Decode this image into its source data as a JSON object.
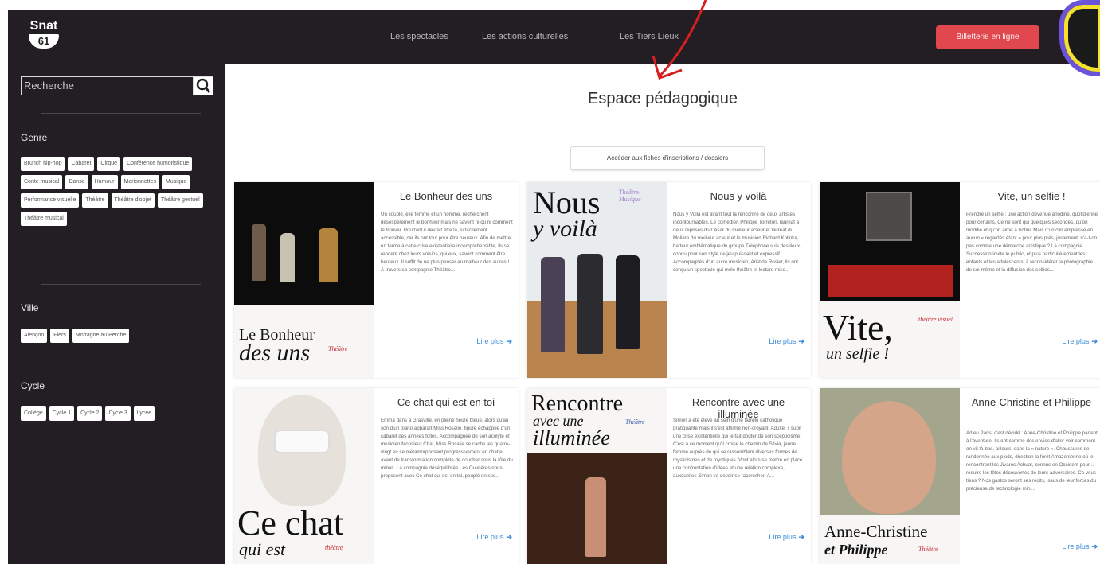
{
  "logo": {
    "line1": "Snat",
    "line2": "61"
  },
  "nav": [
    "Les spectacles",
    "Les actions culturelles",
    "Les Tiers Lieux"
  ],
  "ticket_button": "Billetterie en ligne",
  "search": {
    "placeholder": "Recherche"
  },
  "filters": [
    {
      "title": "Genre",
      "tags": [
        "Brunch hip-hop",
        "Cabaret",
        "Cirque",
        "Conférence humoristique",
        "Conte musical",
        "Danse",
        "Humour",
        "Marionnettes",
        "Musique",
        "Performance visuelle",
        "Théâtre",
        "Théâtre d'objet",
        "Théâtre gestuel",
        "Théâtre musical"
      ]
    },
    {
      "title": "Ville",
      "tags": [
        "Alençon",
        "Flers",
        "Mortagne au Perche"
      ]
    },
    {
      "title": "Cycle",
      "tags": [
        "Collège",
        "Cycle 1",
        "Cycle 2",
        "Cycle 3",
        "Lycée"
      ]
    }
  ],
  "page_title": "Espace pédagogique",
  "fiches_button": "Accéder aux fiches d'inscriptions / dossiers",
  "read_more": "Lire plus",
  "cards": [
    {
      "title": "Le Bonheur des uns",
      "poster": [
        "Le Bonheur",
        "des uns"
      ],
      "poster_tag": "Théâtre",
      "text": "Un couple, elle femme et un homme, recherchent désespérément le bonheur mais ne savent ni où ni comment le trouver. Pourtant il devrait être là, si facilement accessible, car ils ont tout pour être heureux. Afin de mettre un terme à cette crise existentielle incompréhensible, ils se rendent chez leurs voisins, qui eux, savent comment être heureux. Il suffit de ne plus penser au malheur des autres ! À travers sa compagnie Théâtre..."
    },
    {
      "title": "Nous y voilà",
      "poster": [
        "Nous",
        "y voilà"
      ],
      "poster_tag": "Théâtre/ Musique",
      "text": "Nous y Voilà est avant tout la rencontre de deux artistes incontournables. Le comédien Philippe Torreton, lauréat à deux reprises du César du meilleur acteur et lauréat du Molière du meilleur acteur et le musicien Richard Kolinka, batteur emblématique du groupe Téléphone suis des lieux, connu pour son style de jeu puissant et expressif. Accompagnés d'un autre musicien, Aristide Rosier, ils ont conçu un spectacle qui mêle théâtre et lecture mise..."
    },
    {
      "title": "Vite, un selfie !",
      "poster": [
        "Vite,",
        "un selfie !"
      ],
      "poster_tag": "théâtre visuel",
      "text": "Prendre un selfie : une action devenue anodine, quotidienne pour certains. Ce ne sont qui quelques secondes, qu'on modifie et qu'on aime à l'infini. Mais d'un clin empressé en aucun « regardés étant » pour plus près, justement, n'a-t-on pas comme une démarche artistique ? La compagnie Succession invite le public, et plus particulièrement les enfants et les adolescents, à reconsidérer la photographie de soi-même et la diffusion des selfies..."
    },
    {
      "title": "Ce chat qui est en toi",
      "poster": [
        "Ce chat",
        "qui est"
      ],
      "poster_tag": "théâtre",
      "text": "Emma dans à Grasville, en pleine heure bleue, alors qu'au son d'un piano apparaît Miss Rosalie, figure échappée d'un cabaret des années folles. Accompagnée de son acolyte et musicien Monsieur Chat, Miss Rosalie se cache les quatre-vingt en se métamorphosant progressivement en chatte, avant de transformation complète de coucher sous la tôle du minuit. La compagnie déséquilibrée Les Ouvrières nous proposent avec Ce chat qui est en toi, peuplé en ses..."
    },
    {
      "title": "Rencontre avec une illuminée",
      "poster": [
        "Rencontre",
        "avec une",
        "illuminée"
      ],
      "poster_tag": "Théâtre",
      "text": "Simon a été élevé au sein d'une famille catholique pratiquante mais il s'est affirmé non-croyant. Adulte, il subit une crise existentielle qui le fait douter de son scepticisme. C'est à ce moment qu'il croise le chemin de Silvia, jeune femme auprès de qui se rassemblent diverses formes de mysticismes et de mystiques. Vont alors se mettre en place une confrontation d'idées et une relation complexe, auxquelles Simon va devoir se raccrocher. A..."
    },
    {
      "title": "Anne-Christine et Philippe",
      "poster": [
        "Anne-Christine",
        "et Philippe"
      ],
      "poster_tag": "Théâtre",
      "text": "Adieu Paris, c'est décidé : Anne-Christine et Philippe partent à l'aventure. Ils ont comme des envies d'aller voir comment on vit là-bas, ailleurs, dans la « nature ». Chaussures de randonnée aux pieds, direction la forêt Amazonienne où le rencontrent les Jivaros Achuar, connus en Occident pour... réduire les têtes découvertes de leurs adversaires. Ce vous tiens ? Nos gastos seront ses récits, issus de leur forces du précieuse de technologie mini..."
    }
  ]
}
